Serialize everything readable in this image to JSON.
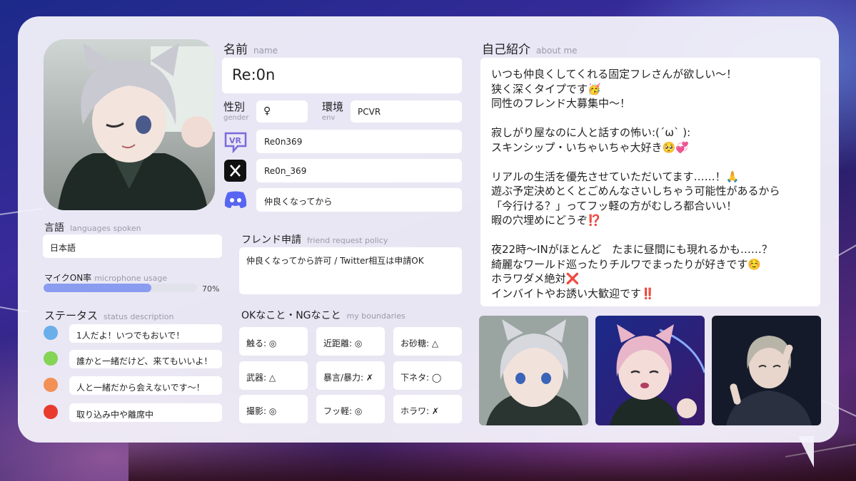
{
  "name_section": {
    "heading": "名前",
    "sub": "name",
    "value": "Re:0n"
  },
  "gender": {
    "label": "性別",
    "sub": "gender",
    "value": "♀"
  },
  "env": {
    "label": "環境",
    "sub": "env",
    "value": "PCVR"
  },
  "accounts": [
    {
      "icon": "vrchat-icon",
      "value": "Re0n369"
    },
    {
      "icon": "x-icon",
      "value": "Re0n_369"
    },
    {
      "icon": "discord-icon",
      "value": "仲良くなってから"
    }
  ],
  "languages": {
    "heading": "言語",
    "sub": "languages spoken",
    "value": "日本語"
  },
  "mic": {
    "heading": "マイクON率",
    "sub": "microphone usage",
    "percent_label": "70%",
    "fraction": 0.7
  },
  "status": {
    "heading": "ステータス",
    "sub": "status description",
    "items": [
      {
        "color": "#6aaeea",
        "text": "1人だよ！いつでもおいで！"
      },
      {
        "color": "#84d455",
        "text": "誰かと一緒だけど、来てもいいよ！"
      },
      {
        "color": "#f29055",
        "text": "人と一緒だから会えないです〜！"
      },
      {
        "color": "#e83a2e",
        "text": "取り込み中や離席中"
      }
    ]
  },
  "friend_request": {
    "heading": "フレンド申請",
    "sub": "friend request policy",
    "value": "仲良くなってから許可 / Twitter相互は申請OK"
  },
  "boundaries": {
    "heading": "OKなこと・NGなこと",
    "sub": "my boundaries",
    "items": [
      "触る: ◎",
      "近距離: ◎",
      "お砂糖: △",
      "武器: △",
      "暴言/暴力: ✗",
      "下ネタ: ◯",
      "撮影: ◎",
      "フッ軽: ◎",
      "ホラワ: ✗"
    ]
  },
  "about": {
    "heading": "自己紹介",
    "sub": "about me",
    "lines": [
      "いつも仲良くしてくれる固定フレさんが欲しい〜！",
      "狭く深くタイプです🥳",
      "同性のフレンド大募集中〜！",
      "",
      "寂しがり屋なのに人と話すの怖い:(ˊωˋ ):",
      "スキンシップ・いちゃいちゃ大好き🥺💞",
      "",
      "リアルの生活を優先させていただいてます……！🙏",
      "遊ぶ予定決めとくとごめんなさいしちゃう可能性があるから",
      "「今行ける？」ってフッ軽の方がむしろ都合いい！",
      "暇の穴埋めにどうぞ⁉️",
      "",
      "夜22時〜INがほとんど　たまに昼間にも現れるかも……？",
      "綺麗なワールド巡ったりチルワでまったりが好きです☺️",
      "ホラワダメ絶対❌",
      "インバイトやお誘い大歓迎です‼️"
    ]
  }
}
